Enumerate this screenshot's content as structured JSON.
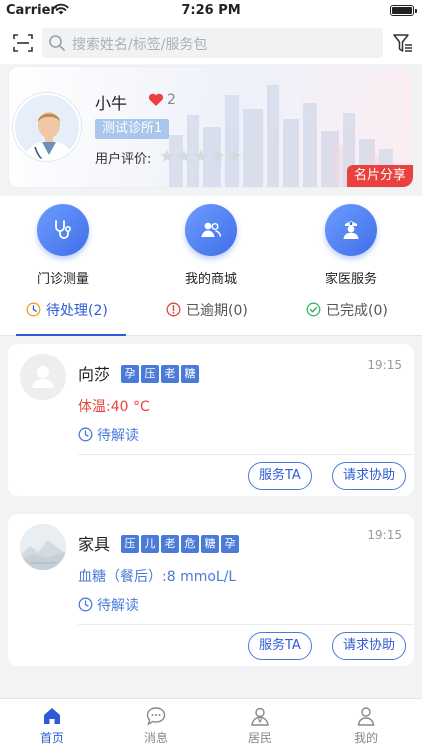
{
  "status_bar": {
    "carrier": "Carrier",
    "time": "7:26 PM"
  },
  "search": {
    "placeholder": "搜索姓名/标签/服务包"
  },
  "profile": {
    "name": "小牛",
    "likes": "2",
    "clinic": "测试诊所1",
    "rating_label": "用户评价:",
    "rating": 0,
    "rating_max": 5,
    "share_label": "名片分享"
  },
  "quick_actions": [
    {
      "label": "门诊测量",
      "icon": "stethoscope-icon"
    },
    {
      "label": "我的商城",
      "icon": "people-icon"
    },
    {
      "label": "家医服务",
      "icon": "nurse-icon"
    }
  ],
  "tabs": [
    {
      "label": "待处理(2)",
      "icon": "hourglass-icon",
      "active": true
    },
    {
      "label": "已逾期(0)",
      "icon": "warning-circle-icon",
      "active": false
    },
    {
      "label": "已完成(0)",
      "icon": "check-circle-icon",
      "active": false
    }
  ],
  "tasks": [
    {
      "name": "向莎",
      "tags": [
        "孕",
        "压",
        "老",
        "糖"
      ],
      "time": "19:15",
      "metric": "体温:40 °C",
      "metric_color": "#e5453c",
      "status": "待解读",
      "btn_serve": "服务TA",
      "btn_help": "请求协助"
    },
    {
      "name": "家具",
      "tags": [
        "压",
        "儿",
        "老",
        "危",
        "糖",
        "孕"
      ],
      "time": "19:15",
      "metric": "血糖（餐后）:8 mmoL/L",
      "metric_color": "#4a7bd8",
      "status": "待解读",
      "btn_serve": "服务TA",
      "btn_help": "请求协助"
    }
  ],
  "bottom_nav": [
    {
      "label": "首页",
      "icon": "home-icon",
      "active": true
    },
    {
      "label": "消息",
      "icon": "chat-icon",
      "active": false
    },
    {
      "label": "居民",
      "icon": "residents-icon",
      "active": false
    },
    {
      "label": "我的",
      "icon": "user-icon",
      "active": false
    }
  ],
  "colors": {
    "accent": "#2f5bd6",
    "tag_blue": "#4a7bd8",
    "share_red": "#e8413e",
    "heart_red": "#e8413e"
  }
}
